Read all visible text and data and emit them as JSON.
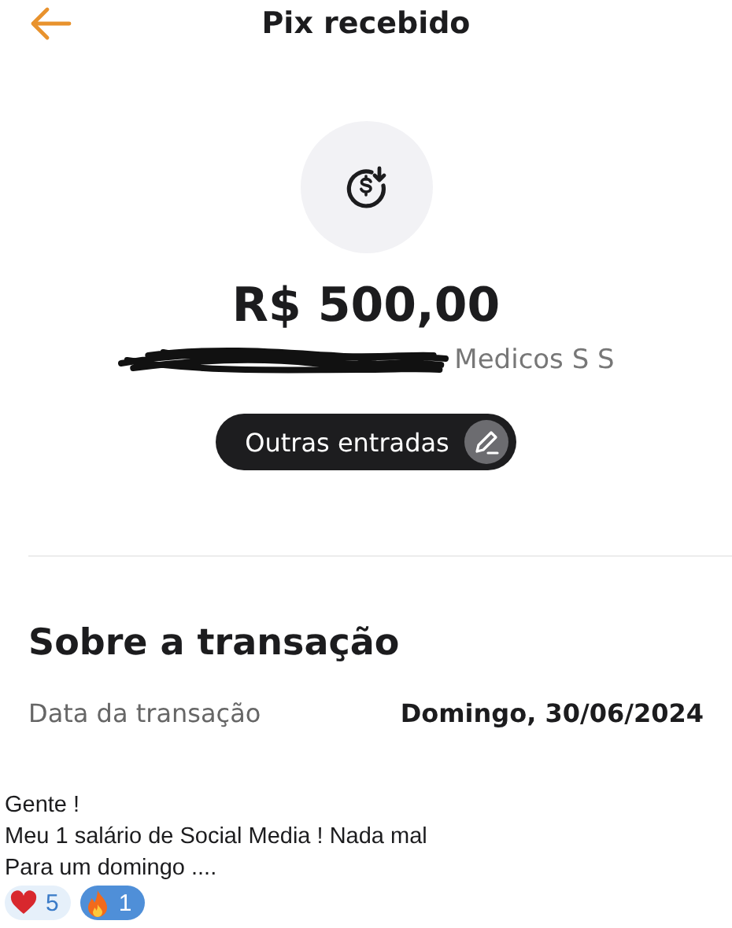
{
  "header": {
    "title": "Pix recebido"
  },
  "amount": "R$ 500,00",
  "payer": "Medicos S S",
  "category_button": {
    "label": "Outras entradas"
  },
  "section": {
    "title": "Sobre a transação",
    "rows": [
      {
        "label": "Data da transação",
        "value": "Domingo, 30/06/2024"
      }
    ]
  },
  "message": {
    "lines": [
      "Gente !",
      "Meu 1 salário de Social Media ! Nada mal",
      "Para um domingo ...."
    ],
    "reactions": [
      {
        "kind": "heart",
        "count": "5",
        "selected": false
      },
      {
        "kind": "fire",
        "count": "1",
        "selected": true
      }
    ]
  }
}
